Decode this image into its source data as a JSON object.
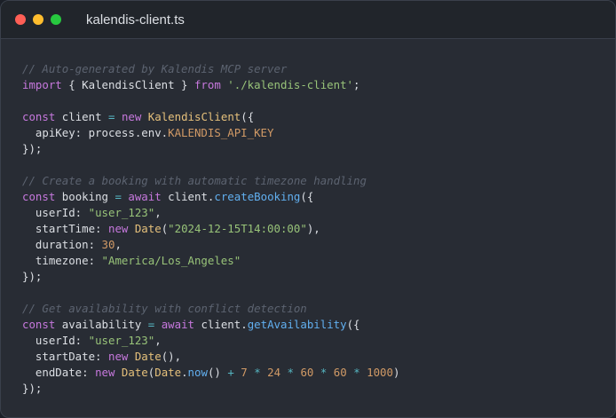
{
  "window": {
    "title": "kalendis-client.ts",
    "controls": {
      "close_color": "#ff5f56",
      "minimize_color": "#ffbd2e",
      "maximize_color": "#27c93f"
    }
  },
  "code": {
    "language": "typescript",
    "lines": [
      [
        {
          "t": "// Auto-generated by Kalendis MCP server",
          "c": "cm"
        }
      ],
      [
        {
          "t": "import",
          "c": "kw"
        },
        {
          "t": " { KalendisClient } "
        },
        {
          "t": "from",
          "c": "kw"
        },
        {
          "t": " "
        },
        {
          "t": "'./kalendis-client'",
          "c": "str"
        },
        {
          "t": ";"
        }
      ],
      [],
      [
        {
          "t": "const",
          "c": "kw"
        },
        {
          "t": " client "
        },
        {
          "t": "=",
          "c": "op"
        },
        {
          "t": " "
        },
        {
          "t": "new",
          "c": "kw"
        },
        {
          "t": " "
        },
        {
          "t": "KalendisClient",
          "c": "cls"
        },
        {
          "t": "({"
        }
      ],
      [
        {
          "t": "  apiKey: process.env."
        },
        {
          "t": "KALENDIS_API_KEY",
          "c": "envv"
        }
      ],
      [
        {
          "t": "});"
        }
      ],
      [],
      [
        {
          "t": "// Create a booking with automatic timezone handling",
          "c": "cm"
        }
      ],
      [
        {
          "t": "const",
          "c": "kw"
        },
        {
          "t": " booking "
        },
        {
          "t": "=",
          "c": "op"
        },
        {
          "t": " "
        },
        {
          "t": "await",
          "c": "kw"
        },
        {
          "t": " client."
        },
        {
          "t": "createBooking",
          "c": "fn"
        },
        {
          "t": "({"
        }
      ],
      [
        {
          "t": "  userId: "
        },
        {
          "t": "\"user_123\"",
          "c": "str"
        },
        {
          "t": ","
        }
      ],
      [
        {
          "t": "  startTime: "
        },
        {
          "t": "new",
          "c": "kw"
        },
        {
          "t": " "
        },
        {
          "t": "Date",
          "c": "cls"
        },
        {
          "t": "("
        },
        {
          "t": "\"2024-12-15T14:00:00\"",
          "c": "str"
        },
        {
          "t": "),"
        }
      ],
      [
        {
          "t": "  duration: "
        },
        {
          "t": "30",
          "c": "num"
        },
        {
          "t": ","
        }
      ],
      [
        {
          "t": "  timezone: "
        },
        {
          "t": "\"America/Los_Angeles\"",
          "c": "str"
        }
      ],
      [
        {
          "t": "});"
        }
      ],
      [],
      [
        {
          "t": "// Get availability with conflict detection",
          "c": "cm"
        }
      ],
      [
        {
          "t": "const",
          "c": "kw"
        },
        {
          "t": " availability "
        },
        {
          "t": "=",
          "c": "op"
        },
        {
          "t": " "
        },
        {
          "t": "await",
          "c": "kw"
        },
        {
          "t": " client."
        },
        {
          "t": "getAvailability",
          "c": "fn"
        },
        {
          "t": "({"
        }
      ],
      [
        {
          "t": "  userId: "
        },
        {
          "t": "\"user_123\"",
          "c": "str"
        },
        {
          "t": ","
        }
      ],
      [
        {
          "t": "  startDate: "
        },
        {
          "t": "new",
          "c": "kw"
        },
        {
          "t": " "
        },
        {
          "t": "Date",
          "c": "cls"
        },
        {
          "t": "(),"
        }
      ],
      [
        {
          "t": "  endDate: "
        },
        {
          "t": "new",
          "c": "kw"
        },
        {
          "t": " "
        },
        {
          "t": "Date",
          "c": "cls"
        },
        {
          "t": "("
        },
        {
          "t": "Date",
          "c": "cls"
        },
        {
          "t": "."
        },
        {
          "t": "now",
          "c": "fn"
        },
        {
          "t": "() "
        },
        {
          "t": "+",
          "c": "op"
        },
        {
          "t": " "
        },
        {
          "t": "7",
          "c": "num"
        },
        {
          "t": " "
        },
        {
          "t": "*",
          "c": "op"
        },
        {
          "t": " "
        },
        {
          "t": "24",
          "c": "num"
        },
        {
          "t": " "
        },
        {
          "t": "*",
          "c": "op"
        },
        {
          "t": " "
        },
        {
          "t": "60",
          "c": "num"
        },
        {
          "t": " "
        },
        {
          "t": "*",
          "c": "op"
        },
        {
          "t": " "
        },
        {
          "t": "60",
          "c": "num"
        },
        {
          "t": " "
        },
        {
          "t": "*",
          "c": "op"
        },
        {
          "t": " "
        },
        {
          "t": "1000",
          "c": "num"
        },
        {
          "t": ")"
        }
      ],
      [
        {
          "t": "});"
        }
      ]
    ]
  }
}
